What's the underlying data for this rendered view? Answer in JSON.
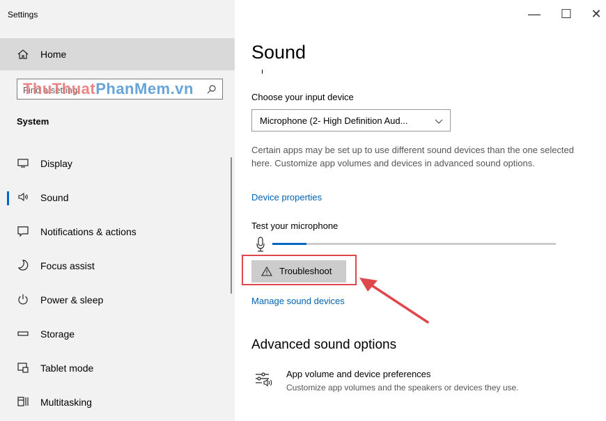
{
  "window": {
    "title": "Settings",
    "minimize": "—",
    "maximize": "☐",
    "close": "✕"
  },
  "sidebar": {
    "home_label": "Home",
    "search_placeholder": "Find a setting",
    "watermark_part1": "ThuThuat",
    "watermark_part2": "PhanMem.vn",
    "section_title": "System",
    "items": [
      {
        "label": "Display",
        "icon": "display-icon"
      },
      {
        "label": "Sound",
        "icon": "speaker-icon",
        "active": true
      },
      {
        "label": "Notifications & actions",
        "icon": "notifications-icon"
      },
      {
        "label": "Focus assist",
        "icon": "moon-icon"
      },
      {
        "label": "Power & sleep",
        "icon": "power-icon"
      },
      {
        "label": "Storage",
        "icon": "storage-icon"
      },
      {
        "label": "Tablet mode",
        "icon": "tablet-mode-icon"
      },
      {
        "label": "Multitasking",
        "icon": "multitasking-icon"
      }
    ]
  },
  "main": {
    "title": "Sound",
    "input_device_label": "Choose your input device",
    "input_device_value": "Microphone (2- High Definition Aud...",
    "description": "Certain apps may be set up to use different sound devices than the one selected here. Customize app volumes and devices in advanced sound options.",
    "device_properties_link": "Device properties",
    "test_mic_label": "Test your microphone",
    "mic_level": 0.12,
    "troubleshoot_label": "Troubleshoot",
    "manage_devices_link": "Manage sound devices",
    "advanced_title": "Advanced sound options",
    "advanced_item_title": "App volume and device preferences",
    "advanced_item_subtitle": "Customize app volumes and the speakers or devices they use."
  },
  "colors": {
    "accent": "#0067c0",
    "link": "#0063b1",
    "highlight": "#e0474b"
  }
}
